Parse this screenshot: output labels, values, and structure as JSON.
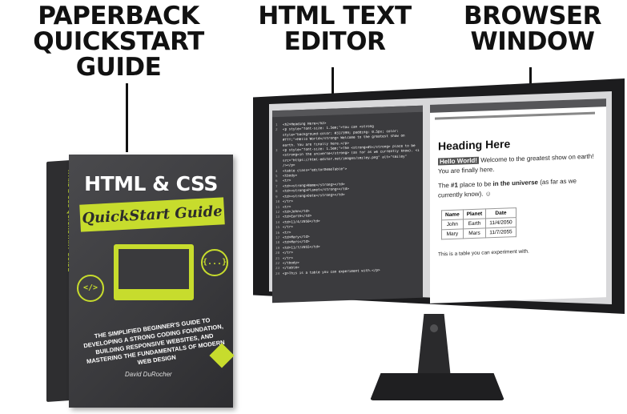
{
  "headings": {
    "book": [
      "PAPERBACK",
      "QUICKSTART",
      "GUIDE"
    ],
    "editor": [
      "HTML TEXT",
      "EDITOR"
    ],
    "browser": [
      "BROWSER",
      "WINDOW"
    ]
  },
  "book": {
    "title": "HTML & CSS",
    "subtitle": "QuickStart Guide",
    "spine": "HTML & CSS QUICKSTART GUIDE",
    "tagline": "The Simplified Beginner's Guide to Developing a Strong Coding Foundation, Building Responsive Websites, and Mastering the Fundamentals of Modern Web Design",
    "author": "David DuRocher",
    "left_icon": "</>",
    "right_icon": "{...}"
  },
  "editor": {
    "lines": [
      {
        "n": "1",
        "code": "<h2>Heading Here</h2>"
      },
      {
        "n": "2",
        "code": "<p style=\"font-size: 1.5em;\">You can <strong"
      },
      {
        "n": "",
        "code": "style=\"background-color: #317399; padding: 0.5px; color:"
      },
      {
        "n": "",
        "code": "#fff;\">Hello World</strong> Welcome to the greatest show on"
      },
      {
        "n": "",
        "code": "earth. You are finally here.</p>"
      },
      {
        "n": "3",
        "code": "<p style=\"font-size: 1.5em;\">The <strong>#1</strong> place to be"
      },
      {
        "n": "",
        "code": "<strong>in the universe</strong> (as far as we currently know). <img"
      },
      {
        "n": "",
        "code": "src=\"https://html-editor.net/images/smiley.png\" alt=\"smiley\""
      },
      {
        "n": "",
        "code": "/></p>"
      },
      {
        "n": "4",
        "code": "<table class=\"editorDemoTable\">"
      },
      {
        "n": "5",
        "code": "<tbody>"
      },
      {
        "n": "6",
        "code": "<tr>"
      },
      {
        "n": "7",
        "code": "<td><strong>Name</strong></td>"
      },
      {
        "n": "8",
        "code": "<td><strong>Planet</strong></td>"
      },
      {
        "n": "9",
        "code": "<td><strong>Date</strong></td>"
      },
      {
        "n": "10",
        "code": "</tr>"
      },
      {
        "n": "11",
        "code": "<tr>"
      },
      {
        "n": "12",
        "code": "<td>John</td>"
      },
      {
        "n": "13",
        "code": "<td>Earth</td>"
      },
      {
        "n": "14",
        "code": "<td>11/4/2050</td>"
      },
      {
        "n": "15",
        "code": "</tr>"
      },
      {
        "n": "16",
        "code": "<tr>"
      },
      {
        "n": "17",
        "code": "<td>Mary</td>"
      },
      {
        "n": "18",
        "code": "<td>Mars</td>"
      },
      {
        "n": "19",
        "code": "<td>11/7/2055</td>"
      },
      {
        "n": "20",
        "code": "</tr>"
      },
      {
        "n": "21",
        "code": "</tr>"
      },
      {
        "n": "22",
        "code": "</tbody>"
      },
      {
        "n": "23",
        "code": "</table>"
      },
      {
        "n": "24",
        "code": "<p>This is a table you can experiment with.</p>"
      }
    ]
  },
  "browser": {
    "heading": "Heading Here",
    "highlight": "Hello World!",
    "p1_rest": " Welcome to the greatest show on earth! You are finally here.",
    "p2_pre": "The ",
    "p2_b1": "#1",
    "p2_mid": " place to be ",
    "p2_b2": "in the universe",
    "p2_post": " (as far as we currently know). ☺",
    "table": {
      "headers": [
        "Name",
        "Planet",
        "Date"
      ],
      "rows": [
        [
          "John",
          "Earth",
          "11/4/2050"
        ],
        [
          "Mary",
          "Mars",
          "11/7/2055"
        ]
      ]
    },
    "footer": "This is a table you can experiment with."
  },
  "colors": {
    "accent": "#c7dc2d",
    "book_dark": "#3a3a3d",
    "monitor": "#1c1c1e"
  }
}
